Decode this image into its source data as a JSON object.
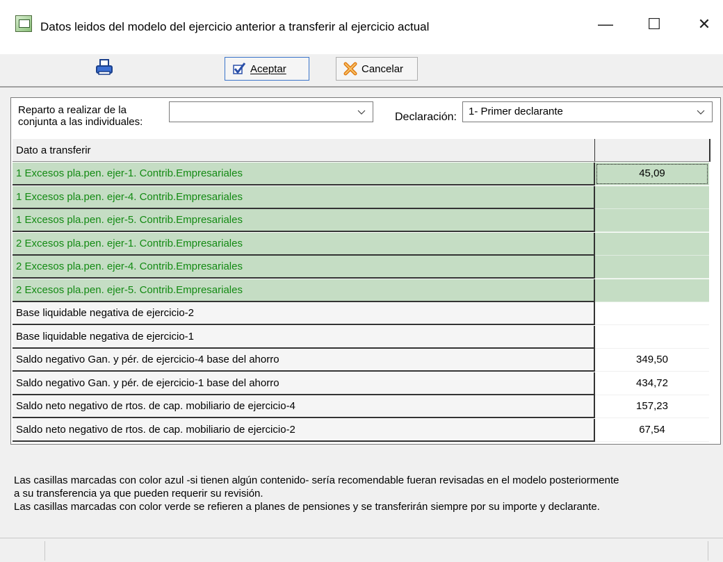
{
  "window": {
    "title": "Datos leidos del modelo del ejercicio anterior a transferir al ejercicio actual",
    "minimize": "—",
    "maximize": "☐",
    "close": "✕"
  },
  "toolbar": {
    "print_icon": "printer-icon",
    "accept_label": "Aceptar",
    "cancel_label": "Cancelar"
  },
  "filters": {
    "reparto_label_line1": "Reparto a realizar de la",
    "reparto_label_line2": "conjunta a las individuales:",
    "reparto_value": "",
    "declaracion_label": "Declaración:",
    "declaracion_value": "1- Primer declarante"
  },
  "grid": {
    "header_col1": "Dato a transferir",
    "header_col2": "",
    "rows": [
      {
        "label": "1 Excesos pla.pen. ejer-1. Contrib.Empresariales",
        "value": "45,09",
        "color": "green"
      },
      {
        "label": "1 Excesos pla.pen. ejer-4. Contrib.Empresariales",
        "value": "",
        "color": "green"
      },
      {
        "label": "1 Excesos pla.pen. ejer-5. Contrib.Empresariales",
        "value": "",
        "color": "green"
      },
      {
        "label": "2 Excesos pla.pen. ejer-1. Contrib.Empresariales",
        "value": "",
        "color": "green"
      },
      {
        "label": "2 Excesos pla.pen. ejer-4. Contrib.Empresariales",
        "value": "",
        "color": "green"
      },
      {
        "label": "2 Excesos pla.pen. ejer-5. Contrib.Empresariales",
        "value": "",
        "color": "green"
      },
      {
        "label": "Base liquidable negativa de ejercicio-2",
        "value": "",
        "color": "white"
      },
      {
        "label": "Base liquidable negativa de ejercicio-1",
        "value": "",
        "color": "white"
      },
      {
        "label": "Saldo negativo Gan. y pér. de ejercicio-4 base del ahorro",
        "value": "349,50",
        "color": "white"
      },
      {
        "label": "Saldo negativo Gan. y pér. de ejercicio-1 base del ahorro",
        "value": "434,72",
        "color": "white"
      },
      {
        "label": "Saldo neto negativo de rtos. de cap. mobiliario de ejercicio-4",
        "value": "157,23",
        "color": "white"
      },
      {
        "label": "Saldo neto negativo de rtos. de cap. mobiliario de ejercicio-2",
        "value": "67,54",
        "color": "white"
      }
    ]
  },
  "notes": {
    "line1": "Las casillas marcadas con color azul -si tienen algún contenido- sería recomendable fueran revisadas en el modelo posteriormente",
    "line2": "a su transferencia ya que pueden requerir su revisión.",
    "line3": "Las casillas marcadas con color verde se refieren a planes de pensiones y se transferirán siempre por su importe y declarante."
  },
  "colors": {
    "green_row_bg": "#c5ddc4",
    "green_row_text": "#138a13",
    "accent_border": "#3a74c9"
  }
}
